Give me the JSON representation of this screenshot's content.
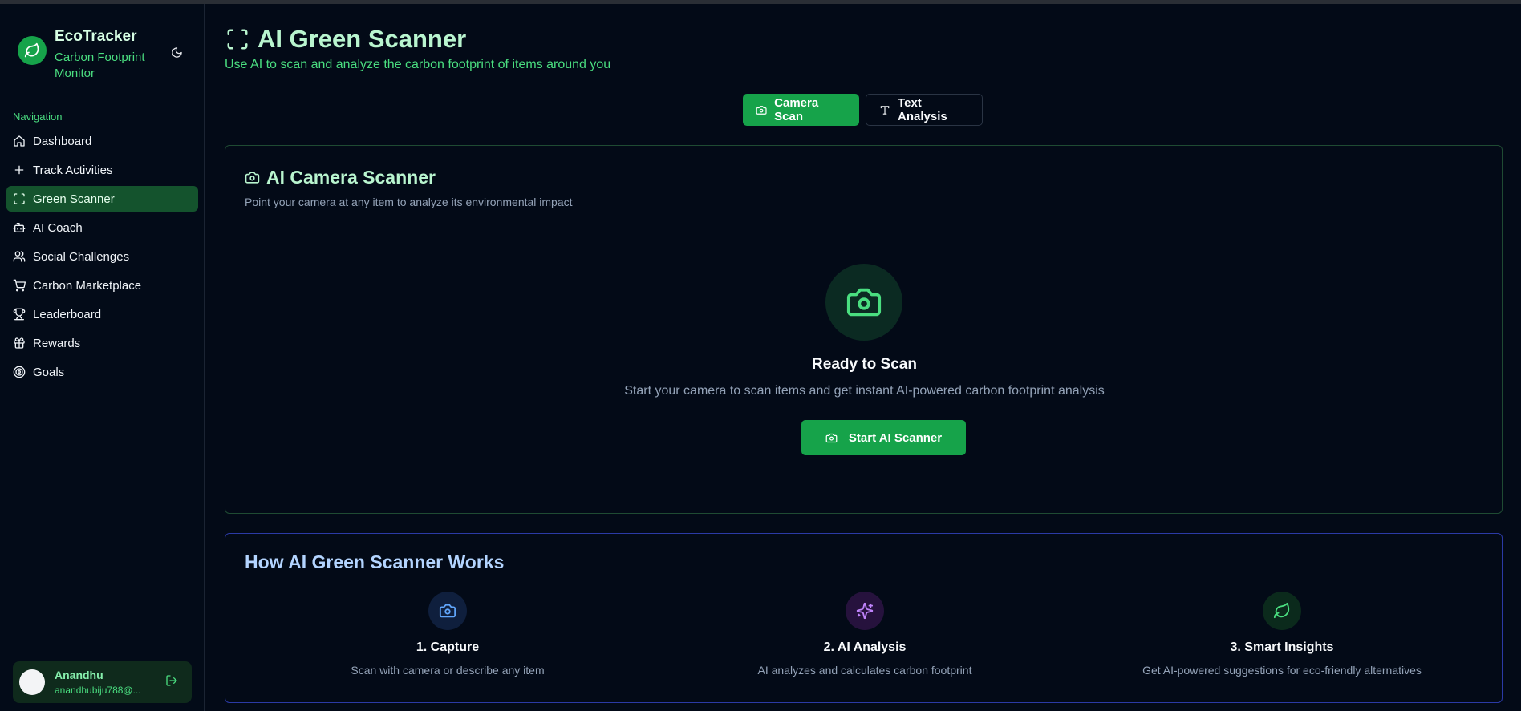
{
  "app": {
    "name": "EcoTracker",
    "subtitle": "Carbon Footprint Monitor"
  },
  "sidebar": {
    "nav_heading": "Navigation",
    "items": [
      {
        "label": "Dashboard",
        "icon": "home-icon"
      },
      {
        "label": "Track Activities",
        "icon": "plus-icon"
      },
      {
        "label": "Green Scanner",
        "icon": "scan-icon",
        "active": true
      },
      {
        "label": "AI Coach",
        "icon": "bot-icon"
      },
      {
        "label": "Social Challenges",
        "icon": "users-icon"
      },
      {
        "label": "Carbon Marketplace",
        "icon": "cart-icon"
      },
      {
        "label": "Leaderboard",
        "icon": "trophy-icon"
      },
      {
        "label": "Rewards",
        "icon": "gift-icon"
      },
      {
        "label": "Goals",
        "icon": "target-icon"
      }
    ],
    "user": {
      "name": "Anandhu",
      "email": "anandhubiju788@..."
    }
  },
  "header": {
    "title": "AI Green Scanner",
    "subtitle": "Use AI to scan and analyze the carbon footprint of items around you"
  },
  "tabs": [
    {
      "label": "Camera Scan",
      "icon": "camera-icon",
      "active": true
    },
    {
      "label": "Text Analysis",
      "icon": "text-icon",
      "active": false
    }
  ],
  "scanner": {
    "title": "AI Camera Scanner",
    "description": "Point your camera at any item to analyze its environmental impact",
    "ready_title": "Ready to Scan",
    "ready_desc": "Start your camera to scan items and get instant AI-powered carbon footprint analysis",
    "start_label": "Start AI Scanner"
  },
  "how": {
    "title": "How AI Green Scanner Works",
    "steps": [
      {
        "title": "1. Capture",
        "desc": "Scan with camera or describe any item",
        "icon": "camera-icon",
        "color": "#60a5fa"
      },
      {
        "title": "2. AI Analysis",
        "desc": "AI analyzes and calculates carbon footprint",
        "icon": "sparkles-icon",
        "color": "#c084fc"
      },
      {
        "title": "3. Smart Insights",
        "desc": "Get AI-powered suggestions for eco-friendly alternatives",
        "icon": "leaf-icon",
        "color": "#4ade80"
      }
    ]
  },
  "colors": {
    "background": "#030a17",
    "accent": "#16a34a",
    "accent_text": "#4ade80",
    "title_text": "#b9f5cf"
  }
}
